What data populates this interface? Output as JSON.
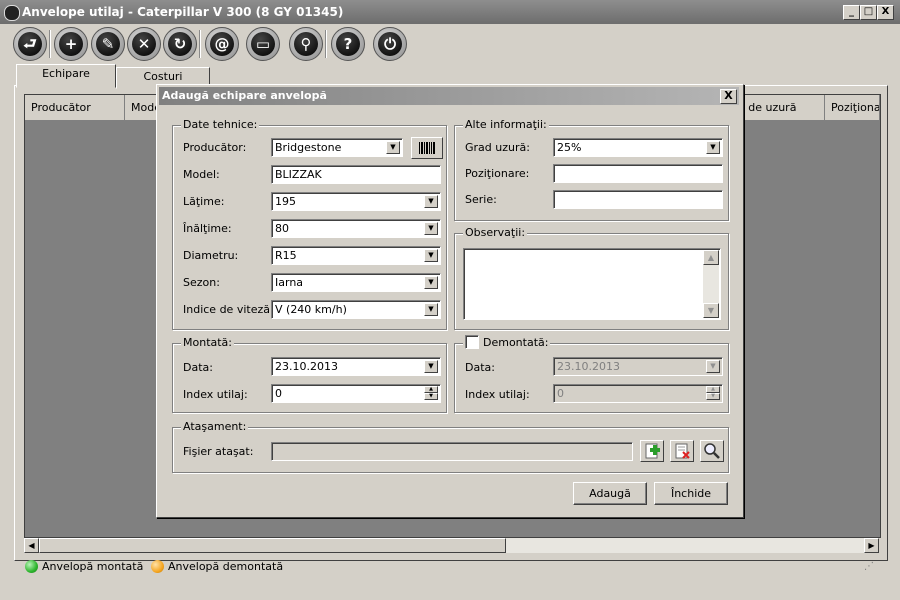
{
  "window": {
    "title": "Anvelope utilaj - Caterpillar  V 300 (8 GY 01345)",
    "minimize": "_",
    "maximize": "□",
    "close": "X"
  },
  "toolbar": [
    {
      "icon": "exit-icon",
      "glyph": "⮐"
    },
    {
      "icon": "add-icon",
      "glyph": "+"
    },
    {
      "icon": "edit-icon",
      "glyph": "✎"
    },
    {
      "icon": "delete-icon",
      "glyph": "✕"
    },
    {
      "icon": "refresh-icon",
      "glyph": "↻"
    },
    {
      "icon": "email-icon",
      "glyph": "@"
    },
    {
      "icon": "print-icon",
      "glyph": "▭"
    },
    {
      "icon": "search-icon",
      "glyph": "⚲"
    },
    {
      "icon": "help-icon",
      "glyph": "?"
    },
    {
      "icon": "power-icon",
      "glyph": "⏻"
    }
  ],
  "tabs": [
    {
      "label": "Echipare"
    },
    {
      "label": "Costuri"
    }
  ],
  "grid": {
    "columns": [
      "Producător",
      "Mode",
      "ad de uzură",
      "Poziţionar"
    ]
  },
  "legend": [
    {
      "label": "Anvelopă montată",
      "color": "#2db52d"
    },
    {
      "label": "Anvelopă demontată",
      "color": "#f5a623"
    }
  ],
  "dialog": {
    "title": "Adaugă echipare anvelopă",
    "close": "X",
    "tech": {
      "title": "Date tehnice:",
      "producer_label": "Producător:",
      "producer_value": "Bridgestone",
      "model_label": "Model:",
      "model_value": "BLIZZAK",
      "width_label": "Lăţime:",
      "width_value": "195",
      "height_label": "Înălţime:",
      "height_value": "80",
      "diameter_label": "Diametru:",
      "diameter_value": "R15",
      "season_label": "Sezon:",
      "season_value": "Iarna",
      "speed_label": "Indice de viteză:",
      "speed_value": "V (240 km/h)"
    },
    "other": {
      "title": "Alte informaţii:",
      "wear_label": "Grad uzură:",
      "wear_value": "25%",
      "position_label": "Poziţionare:",
      "position_value": "",
      "serial_label": "Serie:",
      "serial_value": ""
    },
    "notes": {
      "title": "Observaţii:",
      "value": ""
    },
    "mounted": {
      "title": "Montată:",
      "date_label": "Data:",
      "date_value": "23.10.2013",
      "index_label": "Index utilaj:",
      "index_value": "0"
    },
    "unmounted": {
      "title": "Demontată:",
      "checked": false,
      "date_label": "Data:",
      "date_value": "23.10.2013",
      "index_label": "Index utilaj:",
      "index_value": "0"
    },
    "attachment": {
      "title": "Ataşament:",
      "file_label": "Fişier ataşat:",
      "file_value": ""
    },
    "buttons": {
      "add": "Adaugă",
      "close": "Închide"
    }
  }
}
